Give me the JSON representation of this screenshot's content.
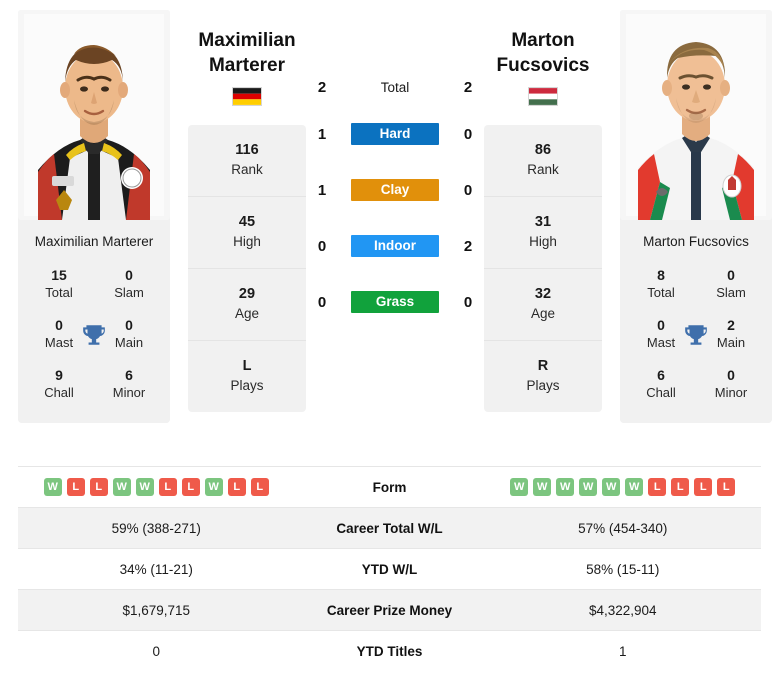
{
  "players": {
    "left": {
      "display_name": "Maximilian\nMarterer",
      "name_line1": "Maximilian",
      "name_line2": "Marterer",
      "full_name": "Maximilian Marterer",
      "country": "Germany",
      "flag_icon": "flag-germany",
      "photo_alt": "Maximilian Marterer portrait",
      "rank": "116",
      "rank_label": "Rank",
      "high": "45",
      "high_label": "High",
      "age": "29",
      "age_label": "Age",
      "plays": "L",
      "plays_label": "Plays",
      "titles": {
        "total": "15",
        "total_label": "Total",
        "slam": "0",
        "slam_label": "Slam",
        "mast": "0",
        "mast_label": "Mast",
        "main": "0",
        "main_label": "Main",
        "chall": "9",
        "chall_label": "Chall",
        "minor": "6",
        "minor_label": "Minor"
      },
      "form": [
        "W",
        "L",
        "L",
        "W",
        "W",
        "L",
        "L",
        "W",
        "L",
        "L"
      ],
      "career_total_wl": "59% (388-271)",
      "ytd_wl": "34% (11-21)",
      "career_prize_money": "$1,679,715",
      "ytd_titles": "0"
    },
    "right": {
      "display_name": "Marton\nFucsovics",
      "name_line1": "Marton",
      "name_line2": "Fucsovics",
      "full_name": "Marton Fucsovics",
      "country": "Hungary",
      "flag_icon": "flag-hungary",
      "photo_alt": "Marton Fucsovics portrait",
      "rank": "86",
      "rank_label": "Rank",
      "high": "31",
      "high_label": "High",
      "age": "32",
      "age_label": "Age",
      "plays": "R",
      "plays_label": "Plays",
      "titles": {
        "total": "8",
        "total_label": "Total",
        "slam": "0",
        "slam_label": "Slam",
        "mast": "0",
        "mast_label": "Mast",
        "main": "2",
        "main_label": "Main",
        "chall": "6",
        "chall_label": "Chall",
        "minor": "0",
        "minor_label": "Minor"
      },
      "form": [
        "W",
        "W",
        "W",
        "W",
        "W",
        "W",
        "L",
        "L",
        "L",
        "L"
      ],
      "career_total_wl": "57% (454-340)",
      "ytd_wl": "58% (15-11)",
      "career_prize_money": "$4,322,904",
      "ytd_titles": "1"
    }
  },
  "head_to_head": {
    "total": {
      "label": "Total",
      "left": "2",
      "right": "2",
      "color": ""
    },
    "surfaces": [
      {
        "label": "Hard",
        "left": "1",
        "right": "0",
        "color": "#0b72c0"
      },
      {
        "label": "Clay",
        "left": "1",
        "right": "0",
        "color": "#e1900b"
      },
      {
        "label": "Indoor",
        "left": "0",
        "right": "2",
        "color": "#2196f3"
      },
      {
        "label": "Grass",
        "left": "0",
        "right": "0",
        "color": "#11a23c"
      }
    ]
  },
  "table": {
    "rows": [
      {
        "label": "Form",
        "type": "form"
      },
      {
        "label": "Career Total W/L",
        "left": "59% (388-271)",
        "right": "57% (454-340)"
      },
      {
        "label": "YTD W/L",
        "left": "34% (11-21)",
        "right": "58% (15-11)"
      },
      {
        "label": "Career Prize Money",
        "left": "$1,679,715",
        "right": "$4,322,904"
      },
      {
        "label": "YTD Titles",
        "left": "0",
        "right": "1"
      }
    ]
  },
  "icons": {
    "trophy": "trophy-icon"
  },
  "colors": {
    "win": "#7cc57f",
    "loss": "#ef5a4a",
    "panel": "#f1f1f1",
    "row_alt": "#f2f2f2"
  }
}
